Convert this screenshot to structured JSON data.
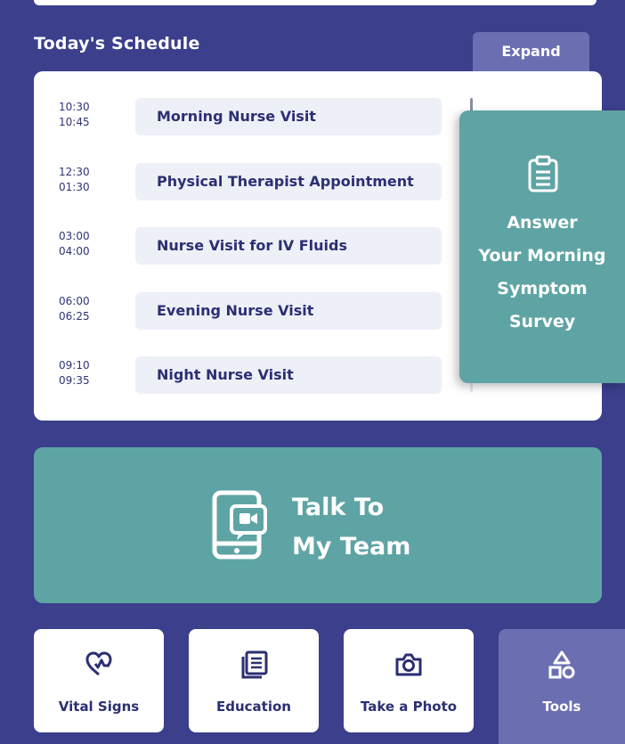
{
  "schedule": {
    "title": "Today's Schedule",
    "expand_label": "Expand",
    "items": [
      {
        "start": "10:30",
        "end": "10:45",
        "label": "Morning Nurse Visit"
      },
      {
        "start": "12:30",
        "end": "01:30",
        "label": "Physical Therapist Appointment"
      },
      {
        "start": "03:00",
        "end": "04:00",
        "label": "Nurse Visit for IV Fluids"
      },
      {
        "start": "06:00",
        "end": "06:25",
        "label": "Evening Nurse Visit"
      },
      {
        "start": "09:10",
        "end": "09:35",
        "label": "Night Nurse Visit"
      }
    ]
  },
  "survey": {
    "icon": "clipboard-icon",
    "label_lines": [
      "Answer",
      "Your Morning",
      "Symptom",
      "Survey"
    ]
  },
  "talk": {
    "icon": "tablet-video-chat-icon",
    "label_lines": [
      "Talk To",
      "My Team"
    ]
  },
  "tools": [
    {
      "icon": "heart-pulse-icon",
      "label": "Vital Signs"
    },
    {
      "icon": "document-icon",
      "label": "Education"
    },
    {
      "icon": "camera-icon",
      "label": "Take a Photo"
    },
    {
      "icon": "shapes-icon",
      "label": "Tools"
    }
  ],
  "colors": {
    "background": "#3b3f8c",
    "teal": "#5fa4a4",
    "lavender": "#6b6fb1",
    "text_dark": "#2b2f72"
  }
}
